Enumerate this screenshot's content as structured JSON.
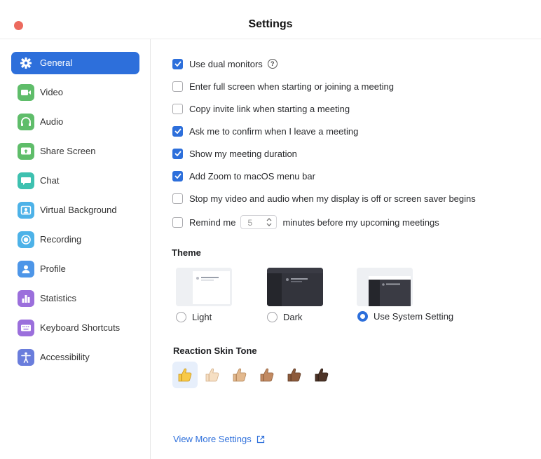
{
  "window": {
    "title": "Settings"
  },
  "sidebar": {
    "items": [
      {
        "label": "General",
        "icon": "gear-icon",
        "color": "#2d6fdb"
      },
      {
        "label": "Video",
        "icon": "video-camera-icon",
        "color": "#5fbd6a"
      },
      {
        "label": "Audio",
        "icon": "headphones-icon",
        "color": "#5fbd6a"
      },
      {
        "label": "Share Screen",
        "icon": "share-screen-icon",
        "color": "#5fbd6a"
      },
      {
        "label": "Chat",
        "icon": "chat-bubble-icon",
        "color": "#3ec1b0"
      },
      {
        "label": "Virtual Background",
        "icon": "person-frame-icon",
        "color": "#4db2e8"
      },
      {
        "label": "Recording",
        "icon": "record-icon",
        "color": "#4db2e8"
      },
      {
        "label": "Profile",
        "icon": "person-icon",
        "color": "#4d96e8"
      },
      {
        "label": "Statistics",
        "icon": "bar-chart-icon",
        "color": "#9b6fdc"
      },
      {
        "label": "Keyboard Shortcuts",
        "icon": "keyboard-icon",
        "color": "#9b6fdc"
      },
      {
        "label": "Accessibility",
        "icon": "accessibility-icon",
        "color": "#6a7ddc"
      }
    ]
  },
  "general": {
    "options": [
      {
        "label": "Use dual monitors",
        "checked": true,
        "help": "?"
      },
      {
        "label": "Enter full screen when starting or joining a meeting",
        "checked": false
      },
      {
        "label": "Copy invite link when starting a meeting",
        "checked": false
      },
      {
        "label": "Ask me to confirm when I leave a meeting",
        "checked": true
      },
      {
        "label": "Show my meeting duration",
        "checked": true
      },
      {
        "label": "Add Zoom to macOS menu bar",
        "checked": true
      },
      {
        "label": "Stop my video and audio when my display is off or screen saver begins",
        "checked": false
      }
    ],
    "remind": {
      "prefix": "Remind me",
      "value": "5",
      "suffix": "minutes before my upcoming meetings",
      "checked": false
    },
    "theme": {
      "title": "Theme",
      "options": [
        {
          "label": "Light",
          "selected": false
        },
        {
          "label": "Dark",
          "selected": false
        },
        {
          "label": "Use System Setting",
          "selected": true
        }
      ]
    },
    "skin_tone": {
      "title": "Reaction Skin Tone",
      "tones": [
        {
          "color": "#f7c948",
          "selected": true
        },
        {
          "color": "#f6dfc3",
          "selected": false
        },
        {
          "color": "#e3b98e",
          "selected": false
        },
        {
          "color": "#c28a62",
          "selected": false
        },
        {
          "color": "#8d5b3c",
          "selected": false
        },
        {
          "color": "#4e3428",
          "selected": false
        }
      ]
    },
    "more_link": "View More Settings"
  },
  "colors": {
    "accent": "#2d6fdb",
    "close": "#ec6a5e"
  }
}
